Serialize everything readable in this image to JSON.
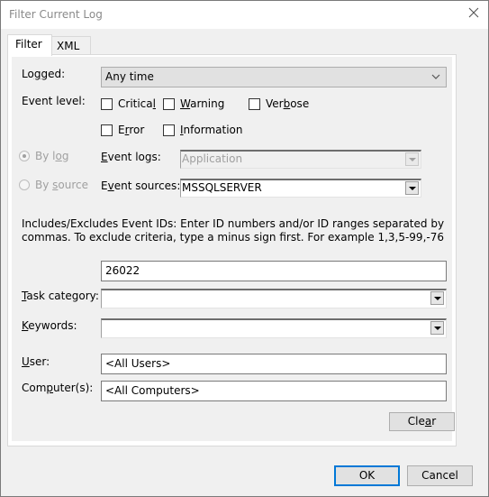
{
  "window": {
    "title": "Filter Current Log",
    "close_icon": "close-icon"
  },
  "tabs": [
    {
      "label": "Filter",
      "active": true
    },
    {
      "label": "XML",
      "active": false
    }
  ],
  "filter": {
    "logged": {
      "label": "Logged:",
      "value": "Any time"
    },
    "event_level": {
      "label": "Event level:",
      "options": [
        {
          "label": "Critical",
          "checked": false
        },
        {
          "label": "Warning",
          "checked": false
        },
        {
          "label": "Verbose",
          "checked": false
        },
        {
          "label": "Error",
          "checked": false
        },
        {
          "label": "Information",
          "checked": false
        }
      ]
    },
    "by_log": {
      "label": "By log",
      "selected": true,
      "enabled": false
    },
    "by_source": {
      "label": "By source",
      "selected": false,
      "enabled": false
    },
    "event_logs": {
      "label": "Event logs:",
      "value": "Application",
      "enabled": false
    },
    "event_sources": {
      "label": "Event sources:",
      "value": "MSSQLSERVER"
    },
    "event_ids": {
      "description": "Includes/Excludes Event IDs: Enter ID numbers and/or ID ranges separated by commas. To exclude criteria, type a minus sign first. For example 1,3,5-99,-76",
      "value": "26022"
    },
    "task_category": {
      "label": "Task category:",
      "value": ""
    },
    "keywords": {
      "label": "Keywords:",
      "value": ""
    },
    "user": {
      "label": "User:",
      "value": "<All Users>"
    },
    "computers": {
      "label": "Computer(s):",
      "value": "<All Computers>"
    },
    "clear_label": "Clear"
  },
  "footer": {
    "ok_label": "OK",
    "cancel_label": "Cancel"
  },
  "colors": {
    "accent": "#0078d7",
    "dialog_bg": "#f0f0f0",
    "disabled_text": "#a0a0a0"
  }
}
